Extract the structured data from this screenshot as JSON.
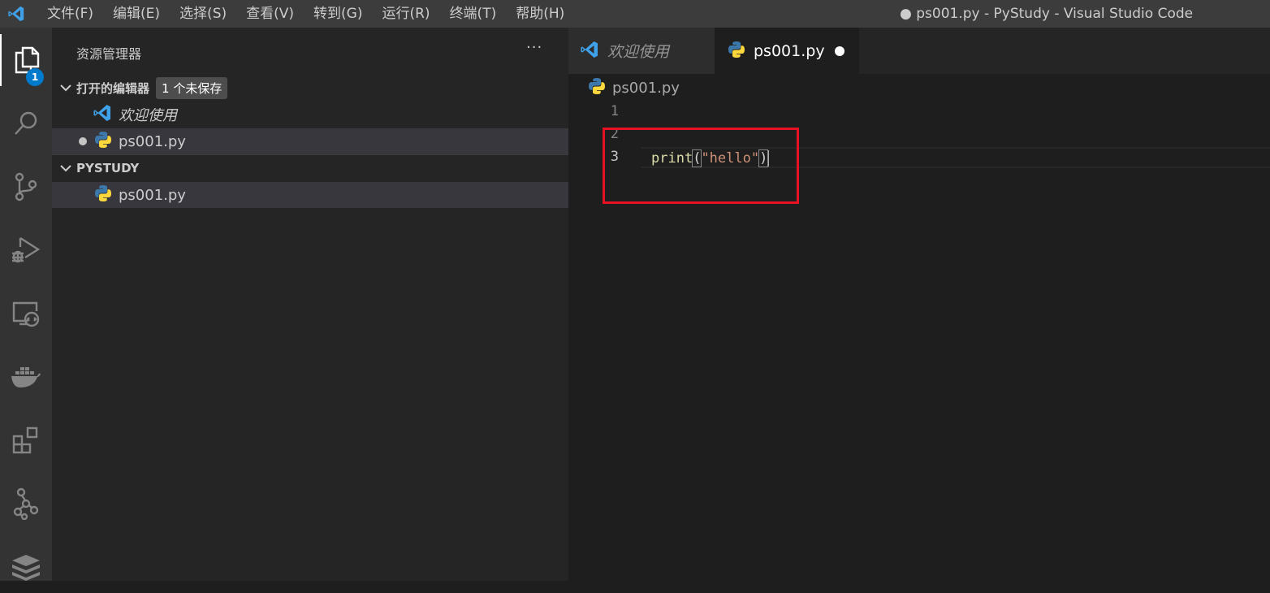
{
  "menu": [
    "文件(F)",
    "编辑(E)",
    "选择(S)",
    "查看(V)",
    "转到(G)",
    "运行(R)",
    "终端(T)",
    "帮助(H)"
  ],
  "window_title": "● ps001.py - PyStudy - Visual Studio Code",
  "activity_bar": {
    "explorer_badge": "1",
    "icons": [
      "files-icon",
      "search-icon",
      "source-control-icon",
      "run-debug-icon",
      "remote-explorer-icon",
      "docker-icon",
      "extensions-icon",
      "graph-icon",
      "database-icon"
    ]
  },
  "sidebar": {
    "header": "资源管理器",
    "more": "···",
    "open_editors": {
      "title": "打开的编辑器",
      "badge": "1 个未保存",
      "items": [
        {
          "label": "欢迎使用",
          "icon": "vscode-icon"
        },
        {
          "label": "ps001.py",
          "icon": "python-icon",
          "dirty": true
        }
      ]
    },
    "workspace": {
      "title": "PYSTUDY",
      "items": [
        {
          "label": "ps001.py",
          "icon": "python-icon"
        }
      ]
    }
  },
  "tabs": [
    {
      "label": "欢迎使用",
      "active": false
    },
    {
      "label": "ps001.py",
      "active": true,
      "dirty": true
    }
  ],
  "breadcrumb": "ps001.py",
  "editor": {
    "line_numbers": [
      "1",
      "2",
      "3"
    ],
    "code": {
      "fn": "print",
      "open_paren": "(",
      "string": "\"hello\"",
      "close_paren": ")"
    }
  },
  "colors": {
    "accent": "#007acc",
    "highlight_box": "#e81123"
  }
}
